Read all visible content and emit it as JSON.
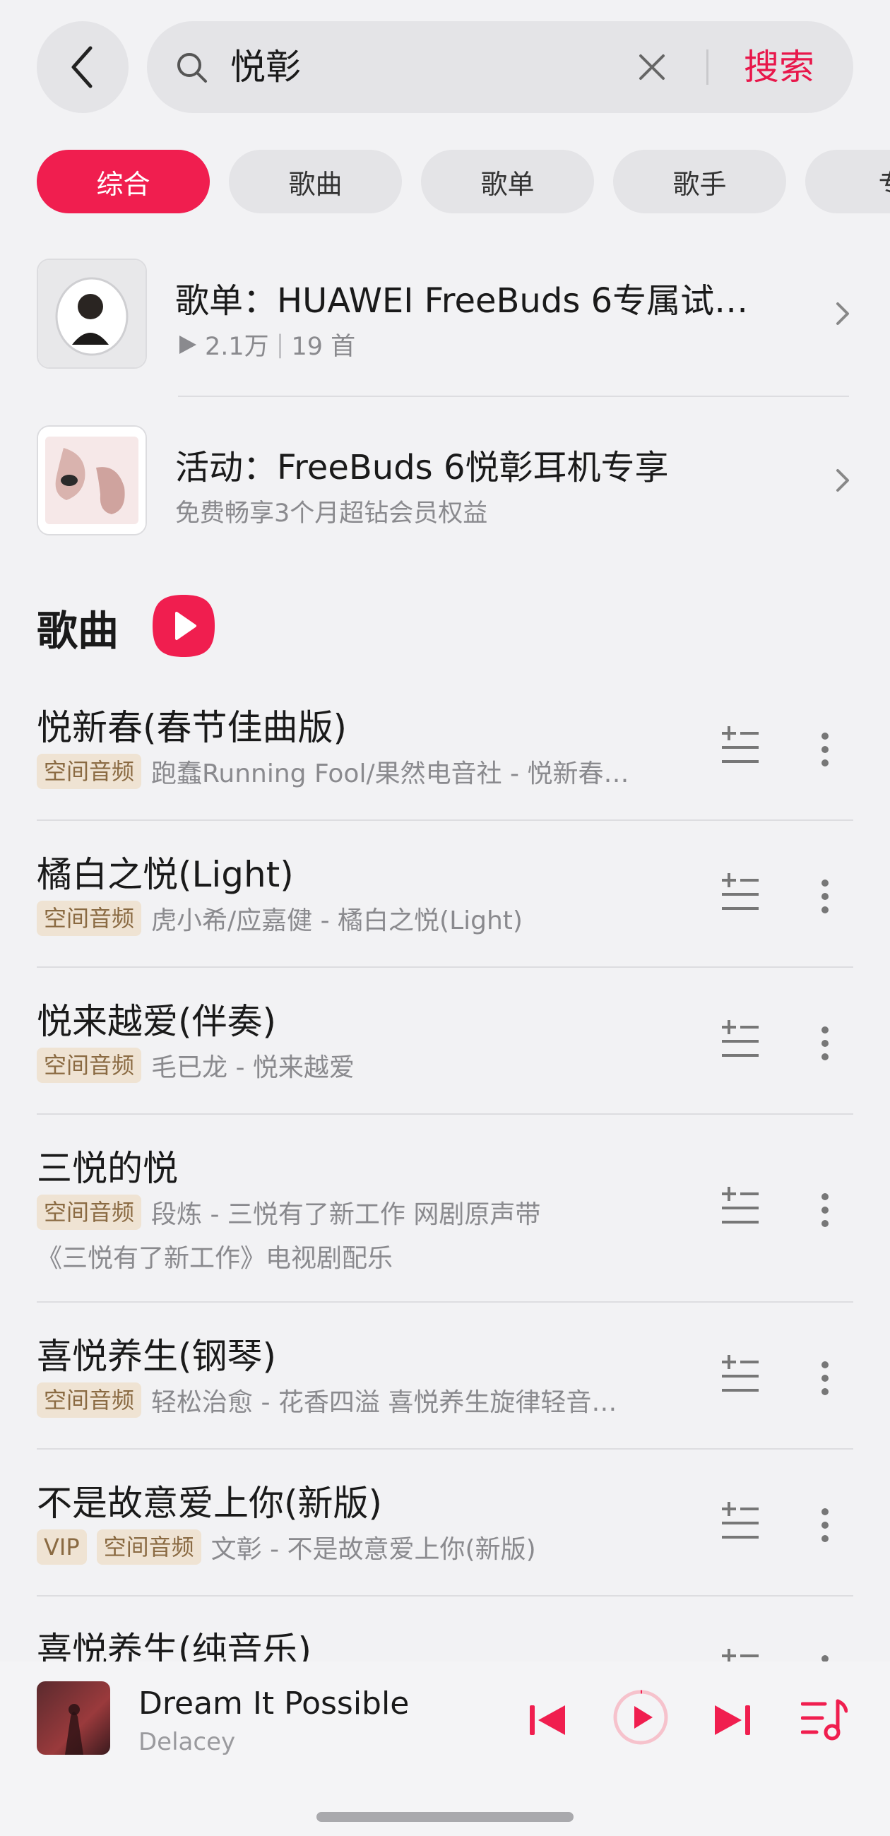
{
  "header": {
    "query": "悦彰",
    "search_label": "搜索"
  },
  "tabs": [
    "综合",
    "歌曲",
    "歌单",
    "歌手",
    "专"
  ],
  "cards": [
    {
      "title": "歌单：HUAWEI FreeBuds 6专属试…",
      "plays": "2.1万",
      "sep": "|",
      "count": "19 首"
    },
    {
      "title": "活动：FreeBuds 6悦彰耳机专享",
      "subtitle": "免费畅享3个月超钻会员权益"
    }
  ],
  "songs_section": {
    "title": "歌曲"
  },
  "songs": [
    {
      "name": "悦新春(春节佳曲版)",
      "badges": [
        "空间音频"
      ],
      "artist": "跑蠢Running Fool/果然电音社 - 悦新春…"
    },
    {
      "name": "橘白之悦(Light)",
      "badges": [
        "空间音频"
      ],
      "artist": "虎小希/应嘉健 - 橘白之悦(Light)"
    },
    {
      "name": "悦来越爱(伴奏)",
      "badges": [
        "空间音频"
      ],
      "artist": "毛已龙 - 悦来越爱"
    },
    {
      "name": "三悦的悦",
      "badges": [
        "空间音频"
      ],
      "artist": "段炼 - 三悦有了新工作 网剧原声带",
      "artist_line2": "《三悦有了新工作》电视剧配乐"
    },
    {
      "name": "喜悦养生(钢琴)",
      "badges": [
        "空间音频"
      ],
      "artist": "轻松治愈 - 花香四溢 喜悦养生旋律轻音…"
    },
    {
      "name": "不是故意爱上你(新版)",
      "badges": [
        "VIP",
        "空间音频"
      ],
      "artist": "文彰 - 不是故意爱上你(新版)"
    },
    {
      "name": "喜悦养生(纯音乐)",
      "badges": [],
      "artist": ""
    }
  ],
  "player": {
    "title": "Dream It Possible",
    "artist": "Delacey"
  },
  "colors": {
    "accent": "#f01e4f",
    "badge_bg": "#efe3d3",
    "badge_text": "#8a6a42",
    "background": "#f2f2f4"
  },
  "icons": [
    "back-icon",
    "search-icon",
    "clear-icon",
    "chevron-right-icon",
    "play-circle-icon",
    "add-to-list-icon",
    "more-icon",
    "previous-icon",
    "play-icon",
    "next-icon",
    "playlist-icon"
  ]
}
